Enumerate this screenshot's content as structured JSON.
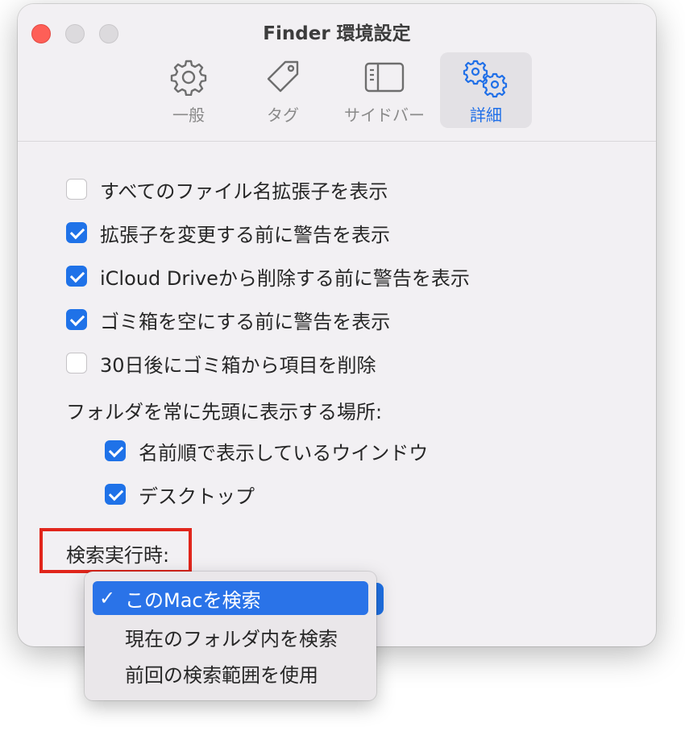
{
  "window": {
    "title": "Finder 環境設定"
  },
  "tabs": [
    {
      "label": "一般",
      "icon": "gear-icon"
    },
    {
      "label": "タグ",
      "icon": "tag-icon"
    },
    {
      "label": "サイドバー",
      "icon": "sidebar-icon"
    },
    {
      "label": "詳細",
      "icon": "gears-icon",
      "active": true
    }
  ],
  "options": [
    {
      "label": "すべてのファイル名拡張子を表示",
      "checked": false
    },
    {
      "label": "拡張子を変更する前に警告を表示",
      "checked": true
    },
    {
      "label": "iCloud Driveから削除する前に警告を表示",
      "checked": true
    },
    {
      "label": "ゴミ箱を空にする前に警告を表示",
      "checked": true
    },
    {
      "label": "30日後にゴミ箱から項目を削除",
      "checked": false
    }
  ],
  "folders_first": {
    "heading": "フォルダを常に先頭に表示する場所:",
    "items": [
      {
        "label": "名前順で表示しているウインドウ",
        "checked": true
      },
      {
        "label": "デスクトップ",
        "checked": true
      }
    ]
  },
  "search": {
    "label": "検索実行時:",
    "check_mark": "✓",
    "menu_items": [
      {
        "label": "このMacを検索",
        "selected": true
      },
      {
        "label": "現在のフォルダ内を検索",
        "selected": false
      },
      {
        "label": "前回の検索範囲を使用",
        "selected": false
      }
    ]
  },
  "colors": {
    "accent": "#1f72e8",
    "highlight_box": "#e1251b",
    "close_button": "#fe5f57"
  }
}
